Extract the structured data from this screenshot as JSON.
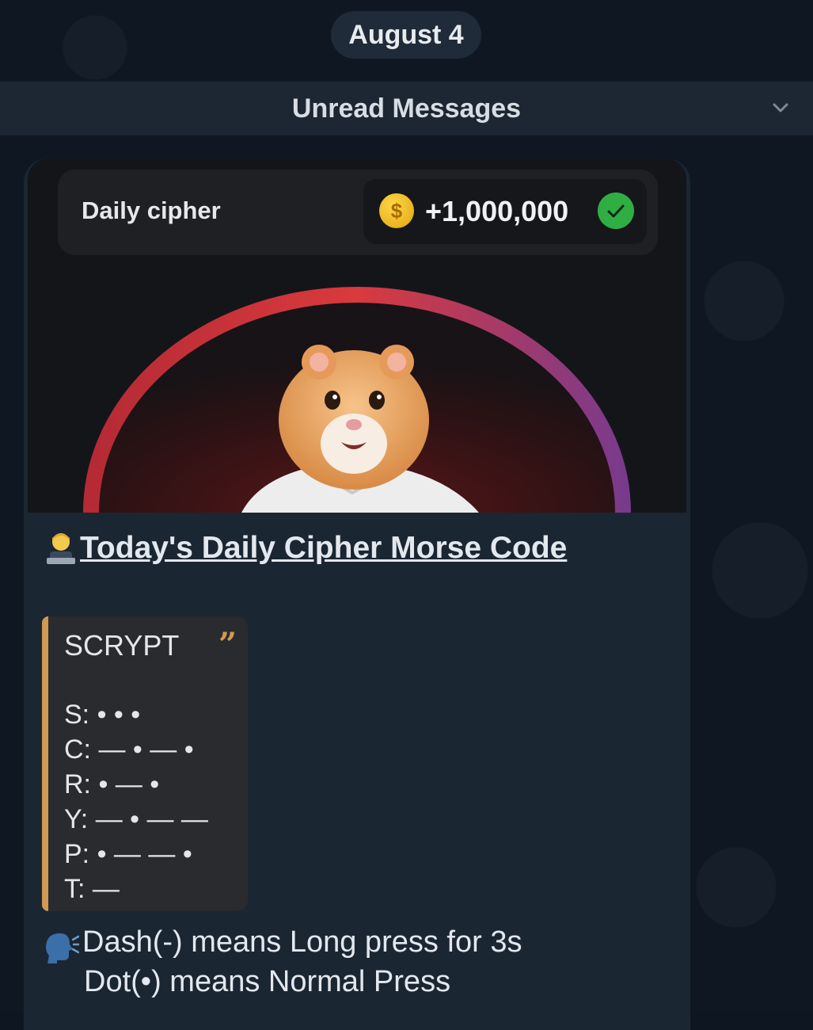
{
  "chat": {
    "date_label": "August 4",
    "unread_label": "Unread Messages"
  },
  "message": {
    "card": {
      "title": "Daily cipher",
      "coin_symbol": "$",
      "reward": "+1,000,000",
      "reward_status": "claimed"
    },
    "caption_title": "Today's Daily Cipher Morse Code",
    "quote": {
      "word": "SCRYPT",
      "lines": [
        "S: • • •",
        "C: — • — •",
        "R: • — •",
        "Y: — • — —",
        "P: • — — •",
        "T: —"
      ]
    },
    "notes": [
      "Dash(-) means Long press for 3s",
      "Dot(•) means Normal Press"
    ]
  },
  "colors": {
    "background": "#0f1822",
    "bubble": "#1b2633",
    "quote_accent": "#d19a52",
    "check_green": "#2fae43",
    "coin_gold": "#f2bf21"
  },
  "icons": {
    "chevron": "chevron-down-icon",
    "coin": "coin-icon",
    "check": "check-circle-icon",
    "quote": "quote-icon",
    "technologist": "technologist-emoji-icon",
    "speaking": "speaking-head-emoji-icon"
  }
}
